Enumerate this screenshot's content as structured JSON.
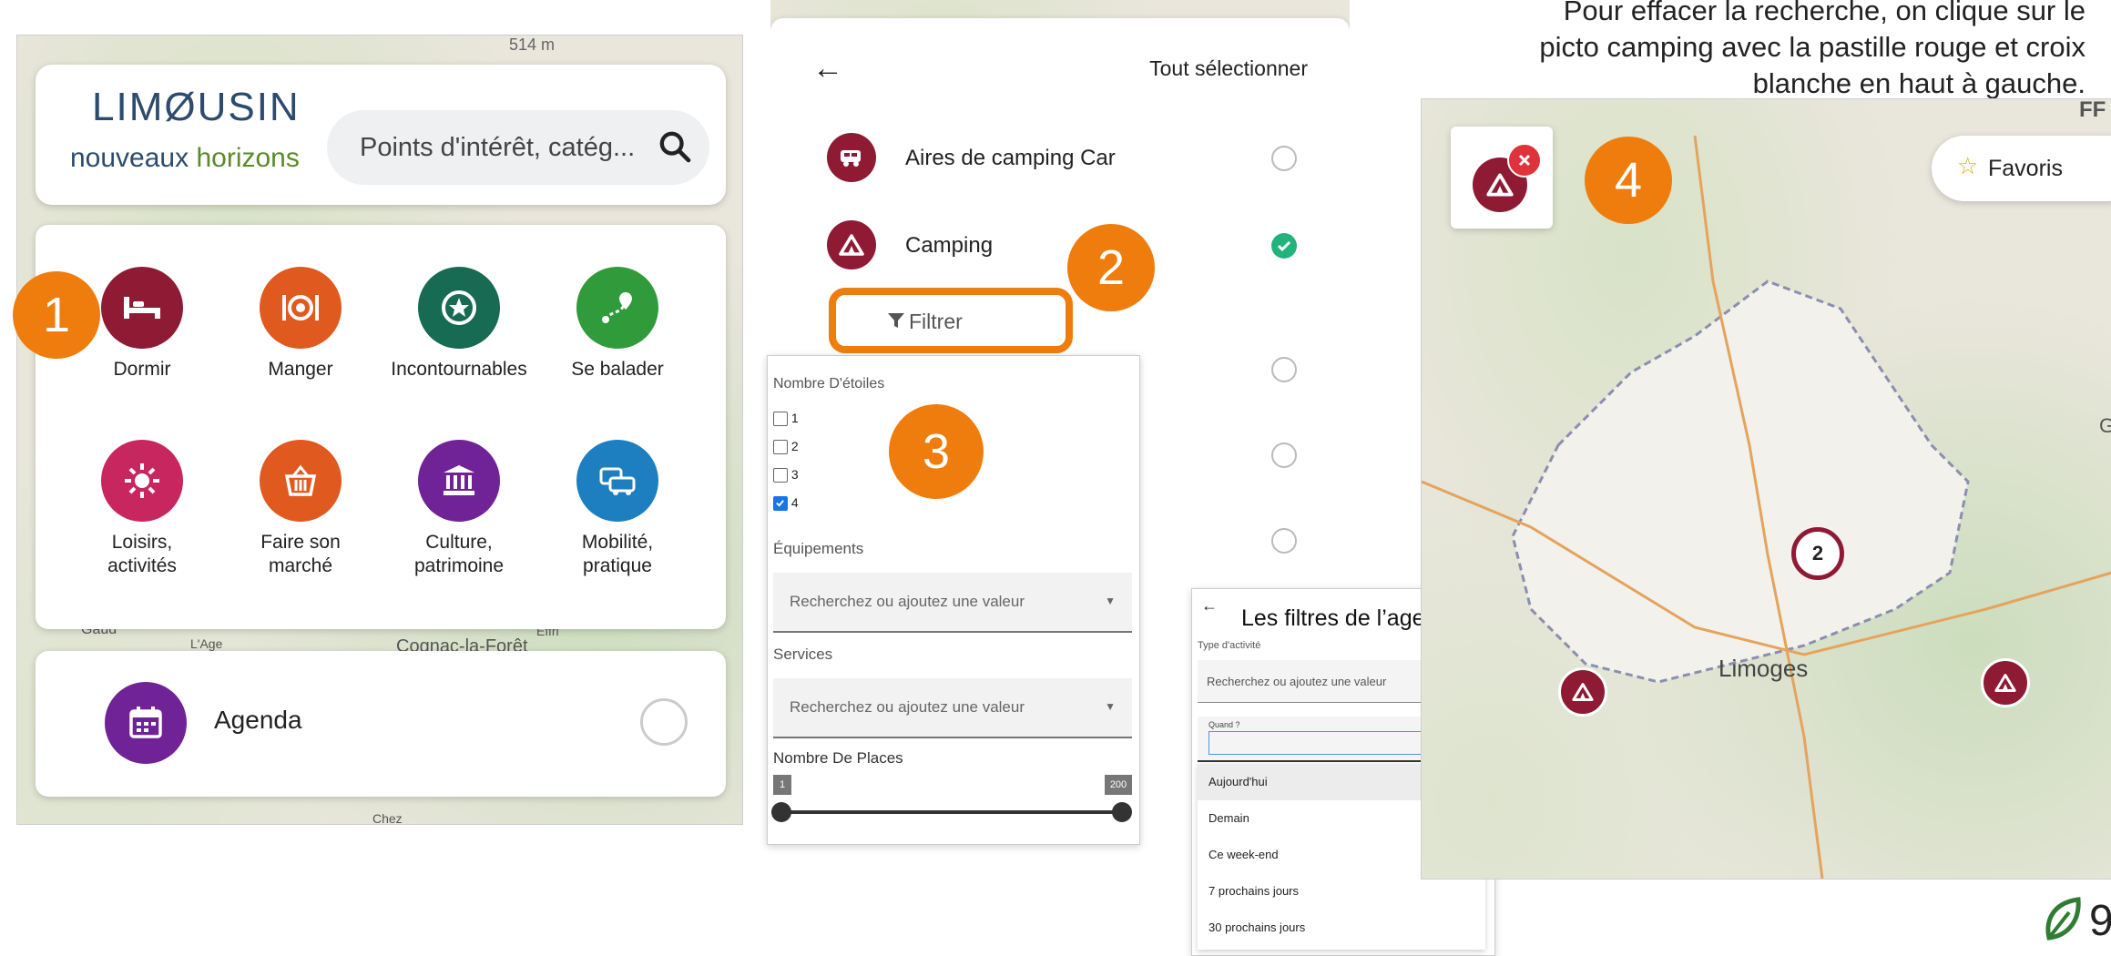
{
  "caption": {
    "line1": "Pour effacer la recherche, on clique sur le",
    "line2": "picto camping avec la pastille rouge et croix",
    "line3": "blanche en haut à gauche."
  },
  "panel1": {
    "map_labels": [
      "514 m",
      "Gaud",
      "L'Age",
      "Cognac-la-Forêt",
      "Effri",
      "Chez"
    ],
    "logo_top": "LIMØUSIN",
    "logo_bottom_a": "nouveaux ",
    "logo_bottom_b": "horizons",
    "search_placeholder": "Points d'intérêt, catég...",
    "categories": [
      {
        "label": "Dormir",
        "color": "#8e1a34",
        "icon": "bed-icon"
      },
      {
        "label": "Manger",
        "color": "#e0591f",
        "icon": "plate-icon"
      },
      {
        "label": "Incontournables",
        "color": "#176b52",
        "icon": "star-icon"
      },
      {
        "label": "Se balader",
        "color": "#2f9b3a",
        "icon": "route-icon"
      },
      {
        "label": "Loisirs,\nactivités",
        "color": "#c8265f",
        "icon": "sun-icon"
      },
      {
        "label": "Faire son\nmarché",
        "color": "#e0591f",
        "icon": "basket-icon"
      },
      {
        "label": "Culture,\npatrimoine",
        "color": "#6f2396",
        "icon": "museum-icon"
      },
      {
        "label": "Mobilité,\npratique",
        "color": "#1d7fc0",
        "icon": "car-icon"
      }
    ],
    "agenda_label": "Agenda",
    "agenda_color": "#6f2396",
    "badge": "1"
  },
  "panel2": {
    "back": "←",
    "select_all": "Tout sélectionner",
    "rows": [
      {
        "label": "Aires de camping Car",
        "checked": false
      },
      {
        "label": "Camping",
        "checked": true
      }
    ],
    "filter_label": "Filtrer",
    "badge": "2",
    "check_color": "#21b37a"
  },
  "panel3": {
    "stars_title": "Nombre D'étoiles",
    "stars": [
      {
        "label": "1",
        "checked": false
      },
      {
        "label": "2",
        "checked": false
      },
      {
        "label": "3",
        "checked": false
      },
      {
        "label": "4",
        "checked": true
      }
    ],
    "equip_title": "Équipements",
    "equip_placeholder": "Recherchez ou ajoutez une valeur",
    "services_title": "Services",
    "services_placeholder": "Recherchez ou ajoutez une valeur",
    "places_title": "Nombre De Places",
    "places_min": "1",
    "places_max": "200",
    "badge": "3"
  },
  "agenda_filter": {
    "back": "←",
    "title": "Les filtres de l’agenda",
    "type_label": "Type d'activité",
    "type_placeholder": "Recherchez ou ajoutez une valeur",
    "when_label": "Quand ?",
    "options": [
      "Aujourd'hui",
      "Demain",
      "Ce week-end",
      "7 prochains jours",
      "30 prochains jours"
    ]
  },
  "panel4": {
    "badge": "4",
    "favoris": "Favoris",
    "cluster": "2",
    "city": "Limoges",
    "map_labels": [
      "FF",
      "G"
    ]
  },
  "page_number": "9"
}
